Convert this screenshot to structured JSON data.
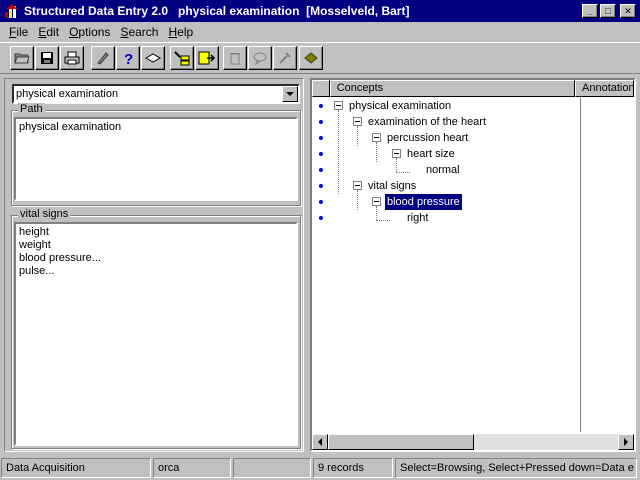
{
  "window": {
    "title": "Structured Data Entry 2.0   physical examination  [Mosselveld, Bart]",
    "minimize": "_",
    "maximize": "□",
    "close": "✕"
  },
  "menu": {
    "items": [
      {
        "label": "File",
        "underline": "F",
        "rest": "ile"
      },
      {
        "label": "Edit",
        "underline": "E",
        "rest": "dit"
      },
      {
        "label": "Options",
        "underline": "O",
        "rest": "ptions"
      },
      {
        "label": "Search",
        "underline": "S",
        "rest": "earch"
      },
      {
        "label": "Help",
        "underline": "H",
        "rest": "elp"
      }
    ]
  },
  "toolbar": {
    "icons": [
      "open-folder-icon",
      "save-icon",
      "print-icon",
      "pencil-icon",
      "help-icon",
      "book-icon",
      "tree-select-icon",
      "document-arrow-icon",
      "trash-icon",
      "speech-bubble-icon",
      "tool-icon",
      "tag-icon"
    ]
  },
  "left": {
    "combo_value": "physical examination",
    "path_label": "Path",
    "path_text": "physical examination",
    "vital_label": "vital signs",
    "vital_items": [
      "height",
      "weight",
      "blood pressure...",
      "pulse..."
    ]
  },
  "right": {
    "col_concepts": "Concepts",
    "col_annotation": "Annotation",
    "tree": [
      {
        "label": "physical examination",
        "level": 0,
        "expander": true
      },
      {
        "label": "examination of the heart",
        "level": 1,
        "expander": true
      },
      {
        "label": "percussion heart",
        "level": 2,
        "expander": true
      },
      {
        "label": "heart size",
        "level": 3,
        "expander": true
      },
      {
        "label": "normal",
        "level": 4,
        "expander": false
      },
      {
        "label": "vital signs",
        "level": 1,
        "expander": true
      },
      {
        "label": "blood pressure",
        "level": 2,
        "expander": true,
        "selected": true
      },
      {
        "label": "right",
        "level": 3,
        "expander": false
      }
    ]
  },
  "status": {
    "mode": "Data Acquisition",
    "db": "orca",
    "blank": "",
    "records": "9 records",
    "hint": "Select=Browsing, Select+Pressed down=Data e"
  },
  "colors": {
    "title_bg": "#000080",
    "selection_bg": "#000080",
    "bullet": "#0000c0"
  }
}
